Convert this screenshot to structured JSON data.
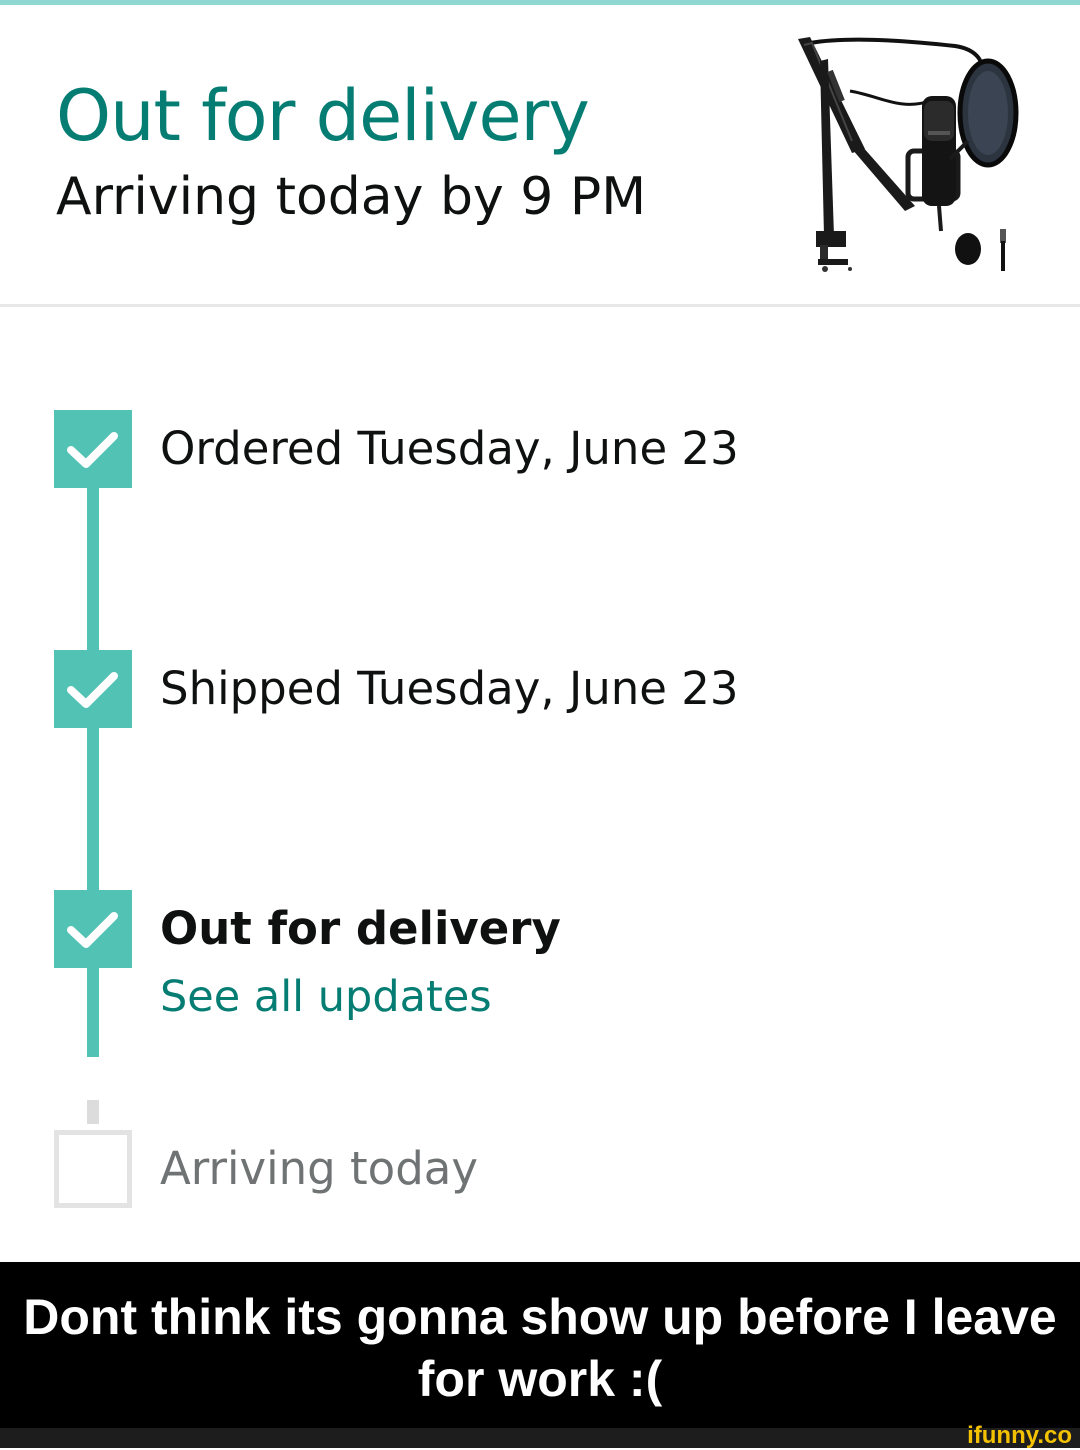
{
  "header": {
    "status_title": "Out for delivery",
    "status_subtitle": "Arriving today by 9 PM",
    "product_image_icon": "microphone-boom-arm-icon"
  },
  "timeline": {
    "steps": [
      {
        "label": "Ordered Tuesday, June 23",
        "completed": true
      },
      {
        "label": "Shipped Tuesday, June 23",
        "completed": true
      },
      {
        "label": "Out for delivery",
        "completed": true,
        "link": "See all updates"
      },
      {
        "label": "Arriving today",
        "completed": false
      }
    ]
  },
  "caption": {
    "line1": "Dont think its gonna show up before I leave",
    "line2": "for work :("
  },
  "watermark": "ifunny.co",
  "colors": {
    "accent_teal": "#067d73",
    "timeline_teal": "#52c2b5",
    "text_dark": "#0f1111",
    "pending_gray": "#e3e3e3",
    "watermark_yellow": "#f2c100"
  }
}
